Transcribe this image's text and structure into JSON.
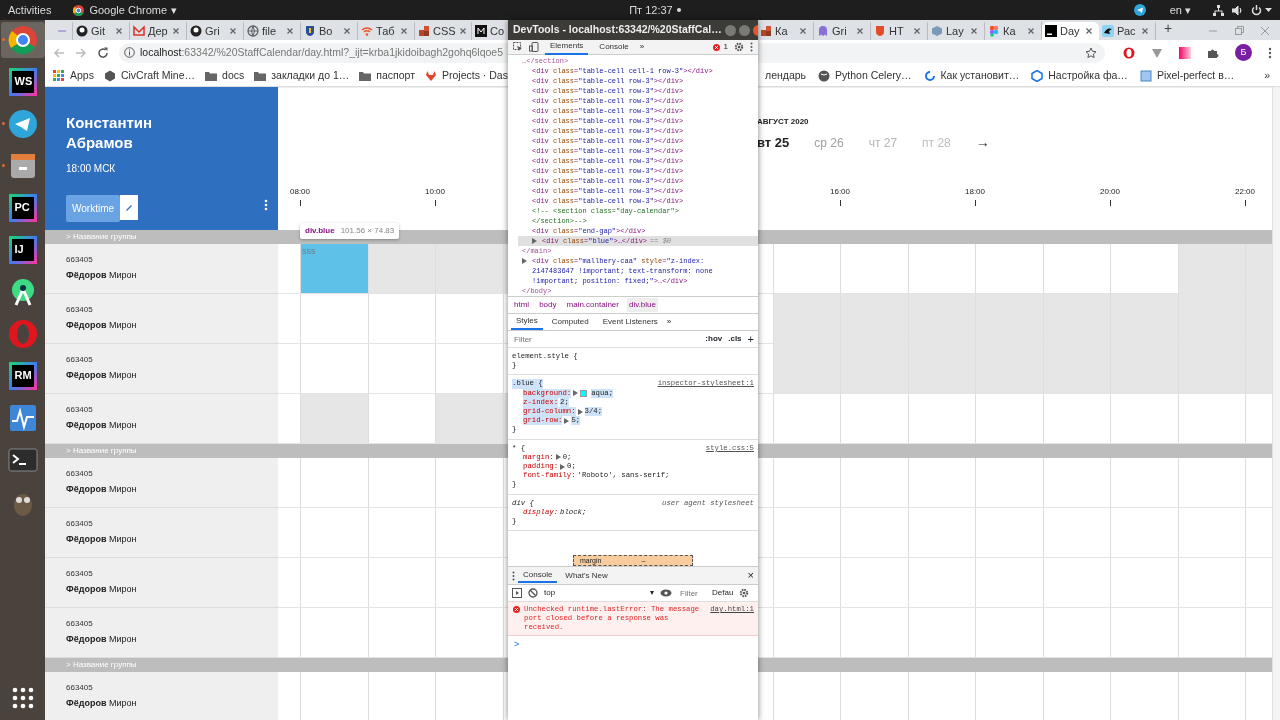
{
  "top_panel": {
    "activities": "Activities",
    "app": "Google Chrome",
    "app_caret": "▾",
    "clock": "Пт 12:37",
    "language": "en",
    "language_caret": "▾"
  },
  "dock": [
    {
      "kind": "chrome",
      "running": true,
      "selected": true
    },
    {
      "kind": "jetbrains",
      "label": "WS",
      "running": false,
      "selected": false
    },
    {
      "kind": "telegram",
      "running": true,
      "selected": false
    },
    {
      "kind": "files",
      "running": true,
      "selected": false
    },
    {
      "kind": "jetbrains",
      "label": "PC",
      "running": false,
      "selected": false
    },
    {
      "kind": "jetbrains",
      "label": "IJ",
      "running": false,
      "selected": false
    },
    {
      "kind": "android",
      "running": false,
      "selected": false
    },
    {
      "kind": "opera",
      "running": false,
      "selected": false
    },
    {
      "kind": "jetbrains",
      "label": "RM",
      "running": false,
      "selected": false
    },
    {
      "kind": "monitor",
      "running": false,
      "selected": false
    },
    {
      "kind": "terminal",
      "running": false,
      "selected": false
    },
    {
      "kind": "gimp",
      "running": false,
      "selected": false
    },
    {
      "kind": "apps",
      "running": false,
      "selected": false
    }
  ],
  "browser": {
    "tabs_left": [
      {
        "selected": false
      },
      {
        "title": "Git",
        "selected": false
      },
      {
        "title": "Дер",
        "selected": false
      },
      {
        "title": "Gri",
        "selected": false
      },
      {
        "title": "file",
        "selected": false
      },
      {
        "title": "Bo",
        "selected": false
      },
      {
        "title": "Таб",
        "selected": false
      },
      {
        "title": "CSS",
        "selected": false
      },
      {
        "title": "Co",
        "selected": false
      }
    ],
    "tabs_right": [
      {
        "title": "Ка",
        "selected": false
      },
      {
        "title": "Gri",
        "selected": false
      },
      {
        "title": "HT",
        "selected": false
      },
      {
        "title": "Lay",
        "selected": false
      },
      {
        "title": "Ка",
        "selected": false
      },
      {
        "title": "Day",
        "selected": true
      },
      {
        "title": "Рас",
        "selected": false
      }
    ],
    "new_tab": "+",
    "address_host": "localhost",
    "address_rest": ":63342/%20StaffCalendar/day.html?_ijt=krba1jkidoibagh2gohq6lqoe5",
    "profile": "Б",
    "bookmarks_left": [
      "Apps",
      "CivCraft Mine…",
      "docs",
      "закладки до 1…",
      "паспорт",
      "Projects · Das"
    ],
    "bookmarks_right": [
      "лендарь",
      "Python Celery…",
      "Как установит…",
      "Настройка фа…",
      "Pixel-perfect в…"
    ],
    "bookmarks_more": "»"
  },
  "page": {
    "person": {
      "name": "Константин Абрамов",
      "time": "18:00 МСК",
      "button": "Worktime"
    },
    "month": "АВГУСТ 2020",
    "days": [
      {
        "label": "вт 25",
        "selected": true
      },
      {
        "label": "ср 26",
        "selected": false
      },
      {
        "label": "чт 27",
        "selected": false
      },
      {
        "label": "пт 28",
        "selected": false
      }
    ],
    "next": "→",
    "time_labels": [
      "08:00",
      "10:00",
      "16:00",
      "18:00",
      "20:00",
      "22:00"
    ],
    "sections": [
      {
        "kind": "group",
        "title": "> Название группы"
      },
      {
        "kind": "person",
        "id": "663405",
        "name": "**Фёдоров** Мирон",
        "busy": [
          false,
          true,
          true,
          true,
          false,
          false,
          false,
          false,
          false,
          false,
          true,
          true
        ],
        "event": {
          "text": "sss"
        }
      },
      {
        "kind": "person",
        "id": "663405",
        "name": "**Фёдоров** Мирон",
        "busy": [
          false,
          false,
          false,
          false,
          true,
          true,
          true,
          true,
          true,
          true,
          true,
          true
        ]
      },
      {
        "kind": "person",
        "id": "663405",
        "name": "**Фёдоров** Мирон",
        "busy": [
          false,
          false,
          false,
          false,
          true,
          true,
          true,
          true,
          true,
          true,
          true,
          true
        ]
      },
      {
        "kind": "person",
        "id": "663405",
        "name": "**Фёдоров** Мирон",
        "busy": [
          true,
          false,
          true,
          true,
          false,
          false,
          false,
          false,
          false,
          false,
          false,
          false
        ]
      },
      {
        "kind": "group",
        "title": "> Название группы"
      },
      {
        "kind": "person",
        "id": "663405",
        "name": "**Фёдоров** Мирон"
      },
      {
        "kind": "person",
        "id": "663405",
        "name": "**Фёдоров** Мирон"
      },
      {
        "kind": "person",
        "id": "663405",
        "name": "**Фёдоров** Мирон"
      },
      {
        "kind": "person",
        "id": "663405",
        "name": "**Фёдоров** Мирон"
      },
      {
        "kind": "group",
        "title": "> Название группы"
      },
      {
        "kind": "person",
        "id": "663405",
        "name": "**Фёдоров** Мирон"
      }
    ],
    "tooltip": {
      "selector": "div.blue",
      "size": "101.56 × 74.83"
    }
  },
  "devtools": {
    "title": "DevTools - localhost:63342/%20StaffCal…",
    "tabs": [
      {
        "label": "Elements",
        "selected": true
      },
      {
        "label": "Console",
        "selected": false
      }
    ],
    "more": "»",
    "errors": "1",
    "elements": [
      {
        "kind": "close",
        "text": "…</section>",
        "selected": false,
        "children": [
          {
            "kind": "element",
            "text": "<div class=\"table-cell cell-1 row-3\"></div>",
            "selected": false
          },
          {
            "kind": "element",
            "text": "<div class=\"table-cell row-3\"></div>",
            "selected": false
          },
          {
            "kind": "element",
            "text": "<div class=\"table-cell row-3\"></div>",
            "selected": false
          },
          {
            "kind": "element",
            "text": "<div class=\"table-cell row-3\"></div>",
            "selected": false
          },
          {
            "kind": "element",
            "text": "<div class=\"table-cell row-3\"></div>",
            "selected": false
          },
          {
            "kind": "element",
            "text": "<div class=\"table-cell row-3\"></div>",
            "selected": false
          },
          {
            "kind": "element",
            "text": "<div class=\"table-cell row-3\"></div>",
            "selected": false
          },
          {
            "kind": "element",
            "text": "<div class=\"table-cell row-3\"></div>",
            "selected": false
          },
          {
            "kind": "element",
            "text": "<div class=\"table-cell row-3\"></div>",
            "selected": false
          },
          {
            "kind": "element",
            "text": "<div class=\"table-cell row-3\"></div>",
            "selected": false
          },
          {
            "kind": "element",
            "text": "<div class=\"table-cell row-3\"></div>",
            "selected": false
          },
          {
            "kind": "element",
            "text": "<div class=\"table-cell row-3\"></div>",
            "selected": false
          },
          {
            "kind": "element",
            "text": "<div class=\"table-cell row-3\"></div>",
            "selected": false
          },
          {
            "kind": "element",
            "text": "<div class=\"table-cell row-3\"></div>",
            "selected": false
          },
          {
            "kind": "comment",
            "text": "<!--    <section class=\"day-calendar\">",
            "selected": false
          },
          {
            "kind": "comment",
            "text": "</section>-->",
            "selected": false
          },
          {
            "kind": "element",
            "text": "<div class=\"end-gap\"></div>",
            "selected": false
          },
          {
            "kind": "element",
            "text": "<div class=\"blue\">…</div>",
            "suffix": "== $0",
            "collapsed": true,
            "selected": true
          }
        ]
      },
      {
        "kind": "close",
        "text": "</main>",
        "selected": false
      },
      {
        "kind": "element",
        "text": "<div class=\"mallbery-caa\" style=\"z-index: 2147483647 !important; text-transform: none !important; position: fixed;\">…</div>",
        "collapsed": true,
        "selected": false
      },
      {
        "kind": "close",
        "text": "</body>",
        "selected": false
      }
    ],
    "breadcrumbs": [
      {
        "label": "html",
        "selected": false
      },
      {
        "label": "body",
        "selected": false
      },
      {
        "label": "main.container",
        "selected": false
      },
      {
        "label": "div.blue",
        "selected": true
      }
    ],
    "style_tabs": [
      {
        "label": "Styles",
        "selected": true
      },
      {
        "label": "Computed",
        "selected": false
      },
      {
        "label": "Event Listeners",
        "selected": false
      }
    ],
    "filter_placeholder": "Filter",
    "hov": ":hov",
    "cls": ".cls",
    "add": "+",
    "rules": [
      {
        "selector": "element.style {",
        "italic": false,
        "highlighted": false
      },
      {
        "selector": ".blue {",
        "source": "inspector-stylesheet:1",
        "italic": false,
        "highlighted": true,
        "props": [
          {
            "name": "background:",
            "value": "aqua;",
            "kind": "color",
            "expandable": true
          },
          {
            "name": "z-index:",
            "value": "2;",
            "kind": "plain",
            "expandable": false
          },
          {
            "name": "grid-column:",
            "value": "3/4;",
            "kind": "plain",
            "expandable": true
          },
          {
            "name": "grid-row:",
            "value": "5;",
            "kind": "plain",
            "expandable": true
          }
        ]
      },
      {
        "selector": "* {",
        "source": "style.css:5",
        "italic": false,
        "highlighted": false,
        "props": [
          {
            "name": "margin:",
            "value": "0;",
            "kind": "plain",
            "expandable": true
          },
          {
            "name": "padding:",
            "value": "0;",
            "kind": "plain",
            "expandable": true
          },
          {
            "name": "font-family:",
            "value": "'Roboto', sans-serif;",
            "kind": "plain",
            "expandable": false
          }
        ]
      },
      {
        "selector": "div {",
        "source": "user agent stylesheet",
        "italic": true,
        "highlighted": false,
        "props": [
          {
            "name": "display:",
            "value": "block;",
            "kind": "plain",
            "expandable": false
          }
        ]
      }
    ],
    "close_brace": "}",
    "box_model": {
      "label": "margin",
      "value": "–"
    },
    "drawer_tabs": [
      {
        "label": "Console",
        "selected": true
      },
      {
        "label": "What's New",
        "selected": false
      }
    ],
    "drawer_close": "×",
    "context": "top",
    "context_caret": "▾",
    "console_filter_placeholder": "Filter",
    "levels": "Defau",
    "error": {
      "message": "Unchecked runtime.lastError: The message port closed before a response was received.",
      "source": "day.html:1"
    },
    "prompt": ">"
  }
}
